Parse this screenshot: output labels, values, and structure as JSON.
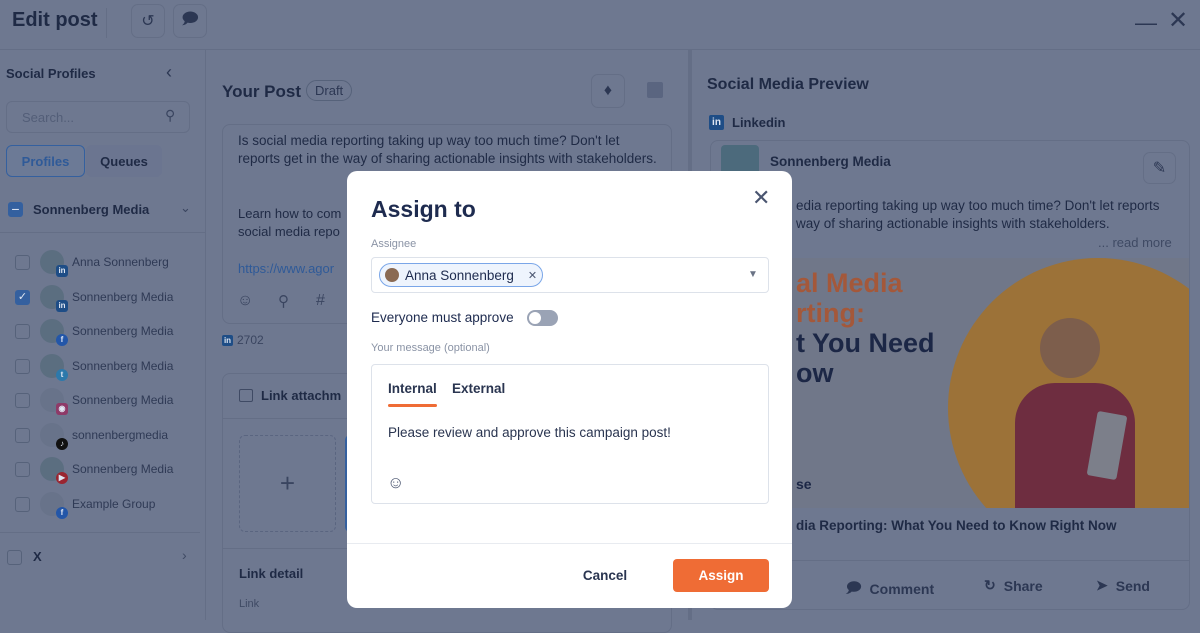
{
  "header": {
    "title": "Edit post",
    "history_icon": "history-icon",
    "comments_icon": "comments-icon",
    "minimize_icon": "minimize-icon",
    "close_icon": "close-icon"
  },
  "sidebar": {
    "title": "Social Profiles",
    "search_placeholder": "Search...",
    "tabs": [
      {
        "label": "Profiles",
        "active": true
      },
      {
        "label": "Queues",
        "active": false
      }
    ],
    "group": {
      "name": "Sonnenberg Media"
    },
    "profiles": [
      {
        "name": "Anna Sonnenberg",
        "network": "linkedin",
        "checked": false
      },
      {
        "name": "Sonnenberg Media",
        "network": "linkedin",
        "checked": true
      },
      {
        "name": "Sonnenberg Media",
        "network": "facebook",
        "checked": false
      },
      {
        "name": "Sonnenberg Media",
        "network": "twitter",
        "checked": false
      },
      {
        "name": "Sonnenberg Media",
        "network": "instagram",
        "checked": false
      },
      {
        "name": "sonnenbergmedia",
        "network": "tiktok",
        "checked": false
      },
      {
        "name": "Sonnenberg Media",
        "network": "youtube",
        "checked": false
      },
      {
        "name": "Example Group",
        "network": "facebook",
        "checked": false
      }
    ],
    "x_group": {
      "name": "X"
    }
  },
  "post": {
    "title": "Your Post",
    "status": "Draft",
    "text_1": "Is social media reporting taking up way too much time? Don't let reports get in the way of sharing actionable insights with stakeholders.",
    "text_2a": "Learn how to com",
    "text_2b": "social media repo",
    "link": "https://www.agor",
    "char_count": "2702",
    "link_attachment": "Link attachm",
    "link_detail": "Link detail",
    "link_label": "Link"
  },
  "preview": {
    "title": "Social Media Preview",
    "network": "Linkedin",
    "account": "Sonnenberg Media",
    "text": "edia reporting taking up way too much time? Don't let reports",
    "text_2": "way of sharing actionable insights with stakeholders.",
    "read_more": "... read more",
    "image_lines": [
      "al Media",
      "rting:",
      "t You Need",
      "ow"
    ],
    "image_small": "se",
    "link_title": "dia Reporting: What You Need to Know Right Now",
    "actions": [
      {
        "label": "Comment"
      },
      {
        "label": "Share"
      },
      {
        "label": "Send"
      }
    ],
    "accent": "#e8703a"
  },
  "modal": {
    "title": "Assign to",
    "assignee_label": "Assignee",
    "assignee": "Anna Sonnenberg",
    "toggle_label": "Everyone must approve",
    "toggle_on": false,
    "message_label": "Your message (optional)",
    "tabs": [
      {
        "label": "Internal",
        "active": true
      },
      {
        "label": "External",
        "active": false
      }
    ],
    "message": "Please review and approve this campaign post!",
    "cancel": "Cancel",
    "assign": "Assign",
    "accent": "#ef6c35"
  }
}
